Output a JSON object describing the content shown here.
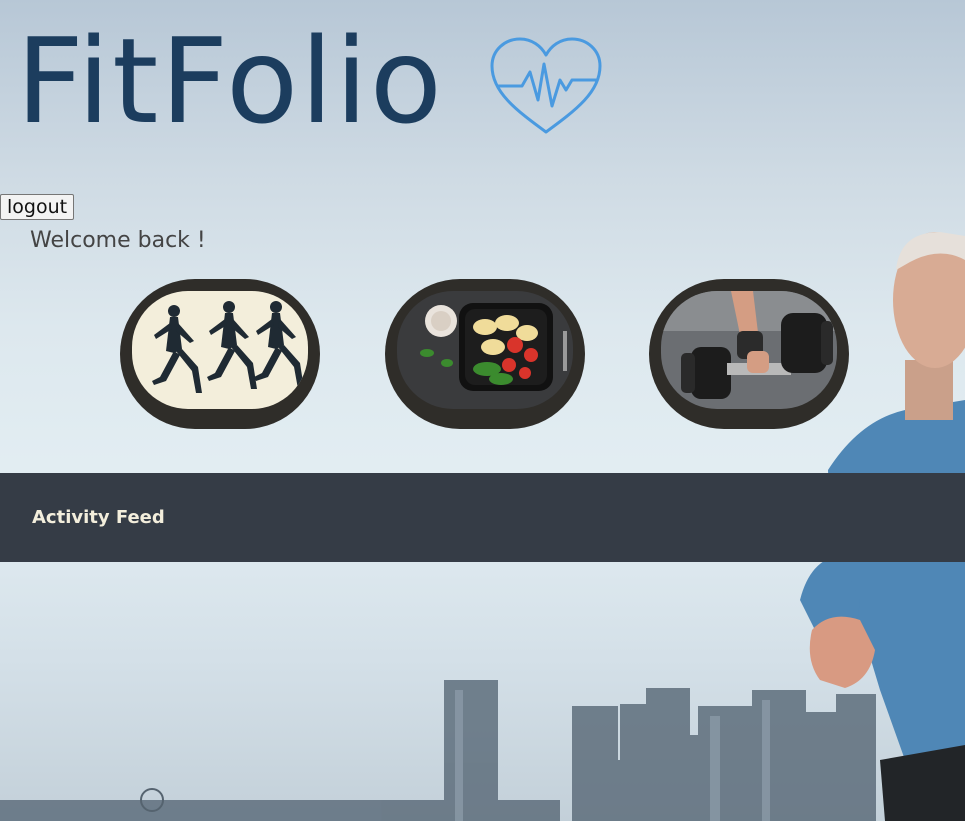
{
  "header": {
    "app_title": "FitFolio",
    "logo_icon": "heart-pulse-icon"
  },
  "session": {
    "logout_label": "logout",
    "welcome_text": "Welcome back !"
  },
  "tiles": [
    {
      "name": "running",
      "icon": "runners-image"
    },
    {
      "name": "nutrition",
      "icon": "meal-bowl-image"
    },
    {
      "name": "strength",
      "icon": "dumbbell-image"
    }
  ],
  "feed": {
    "title": "Activity Feed"
  },
  "colors": {
    "logo": "#1c3d5e",
    "heart": "#4a9ae0",
    "tile_frame": "#2f2d29",
    "feed_bar": "#353c46",
    "feed_text": "#f3eedc"
  }
}
